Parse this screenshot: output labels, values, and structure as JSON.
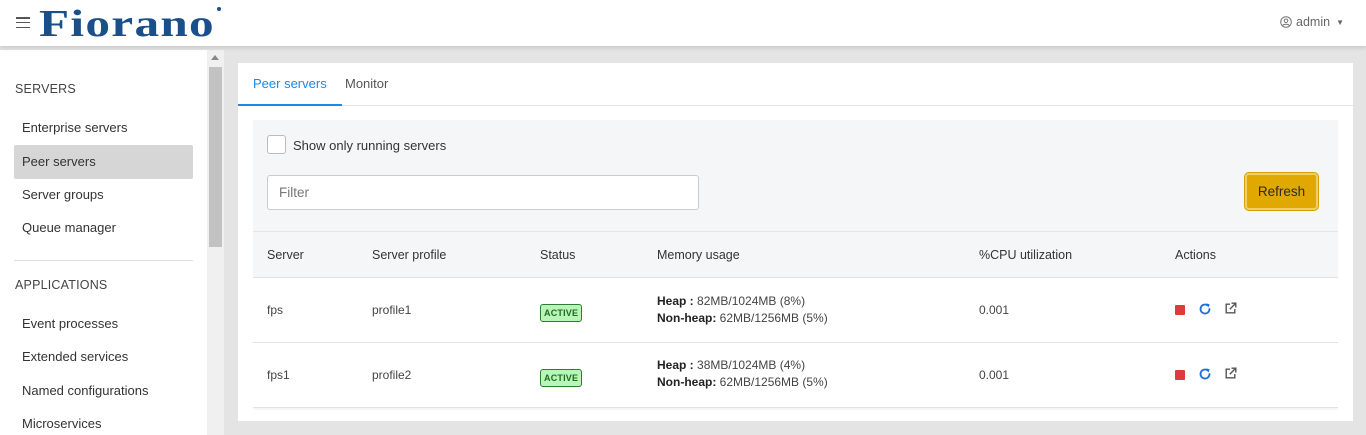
{
  "header": {
    "logo_text": "Fiorano",
    "user": "admin"
  },
  "sidebar": {
    "sections": [
      {
        "heading": "SERVERS",
        "items": [
          "Enterprise servers",
          "Peer servers",
          "Server groups",
          "Queue manager"
        ]
      },
      {
        "heading": "APPLICATIONS",
        "items": [
          "Event processes",
          "Extended services",
          "Named configurations",
          "Microservices"
        ]
      }
    ],
    "active_item": "Peer servers"
  },
  "tabs": [
    {
      "label": "Peer servers",
      "active": true
    },
    {
      "label": "Monitor",
      "active": false
    }
  ],
  "toolbar": {
    "checkbox_label": "Show only running servers",
    "checkbox_checked": false,
    "filter_placeholder": "Filter",
    "filter_value": "",
    "refresh_label": "Refresh"
  },
  "table": {
    "columns": [
      "Server",
      "Server profile",
      "Status",
      "Memory usage",
      "%CPU utilization",
      "Actions"
    ],
    "rows": [
      {
        "server": "fps",
        "profile": "profile1",
        "status": "ACTIVE",
        "heap_label": "Heap :",
        "heap": "82MB/1024MB (8%)",
        "nonheap_label": "Non-heap:",
        "nonheap": "62MB/1256MB (5%)",
        "cpu": "0.001"
      },
      {
        "server": "fps1",
        "profile": "profile2",
        "status": "ACTIVE",
        "heap_label": "Heap :",
        "heap": "38MB/1024MB (4%)",
        "nonheap_label": "Non-heap:",
        "nonheap": "62MB/1256MB (5%)",
        "cpu": "0.001"
      }
    ],
    "actions": [
      "stop-icon",
      "restart-icon",
      "external-link-icon"
    ]
  },
  "colors": {
    "accent": "#1e88e5",
    "brand": "#1a4f8a",
    "refresh_button": "#e0a800",
    "status_active_bg": "#b9f5b9",
    "stop": "#e03b3b"
  }
}
